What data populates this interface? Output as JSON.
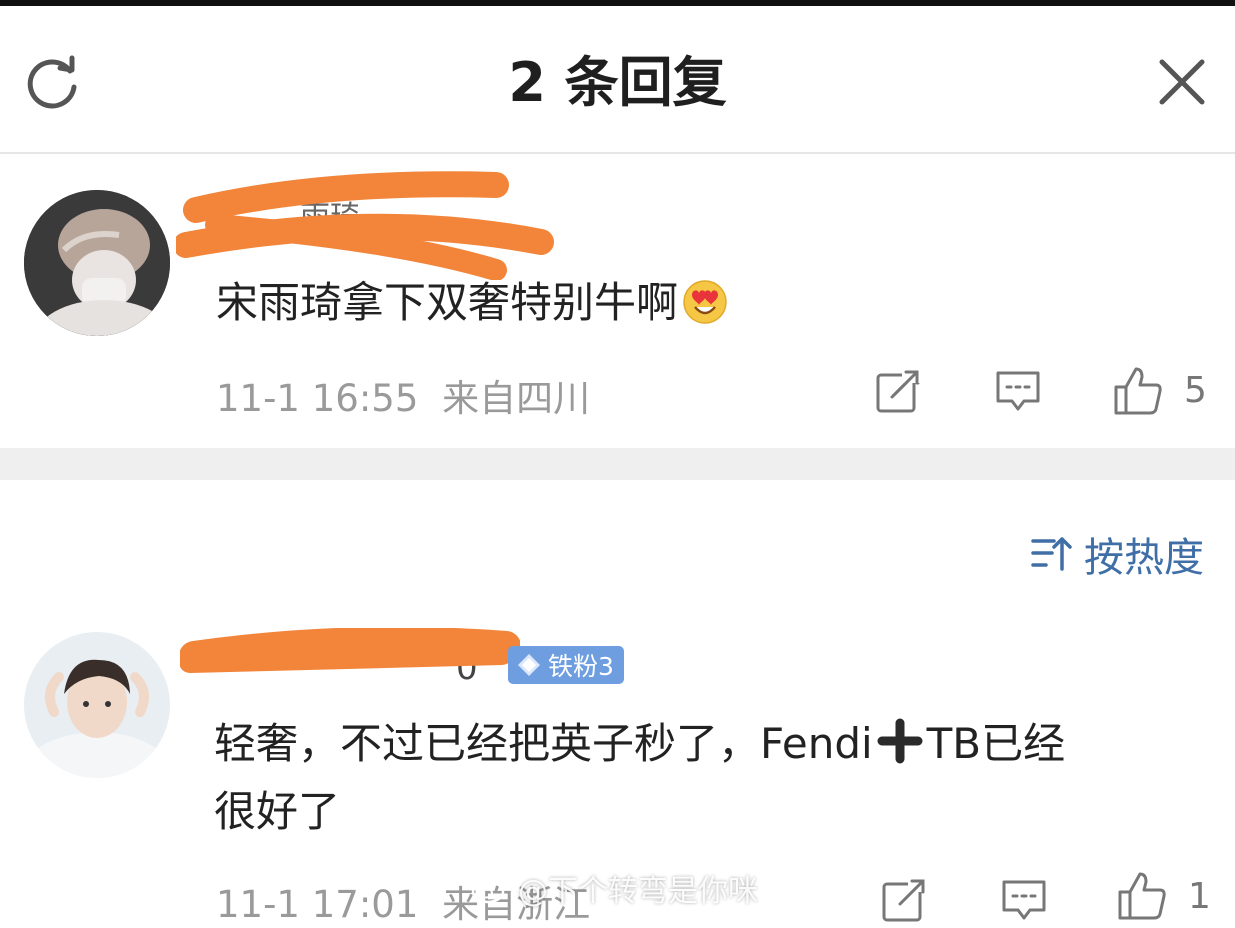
{
  "header": {
    "title": "2 条回复"
  },
  "comment1": {
    "username_visible": "雨琦",
    "text": "宋雨琦拿下双奢特别牛啊",
    "emoji": "heart-eyes-emoji",
    "time": "11-1 16:55",
    "location": "来自四川",
    "likes": "5"
  },
  "sort": {
    "label": "按热度"
  },
  "comment2": {
    "username_visible": "0",
    "badge": "铁粉3",
    "text_part1": "轻奢，不过已经把英子秒了，Fendi",
    "text_part2": "TB已经",
    "text_line2": "很好了",
    "time": "11-1 17:01",
    "location": "来自浙江",
    "likes": "1"
  },
  "watermark": {
    "text": "@下个转弯是你咪"
  },
  "colors": {
    "redaction": "#f2853a",
    "link_blue": "#3f6fa6",
    "badge_blue": "#6f9ee0"
  }
}
